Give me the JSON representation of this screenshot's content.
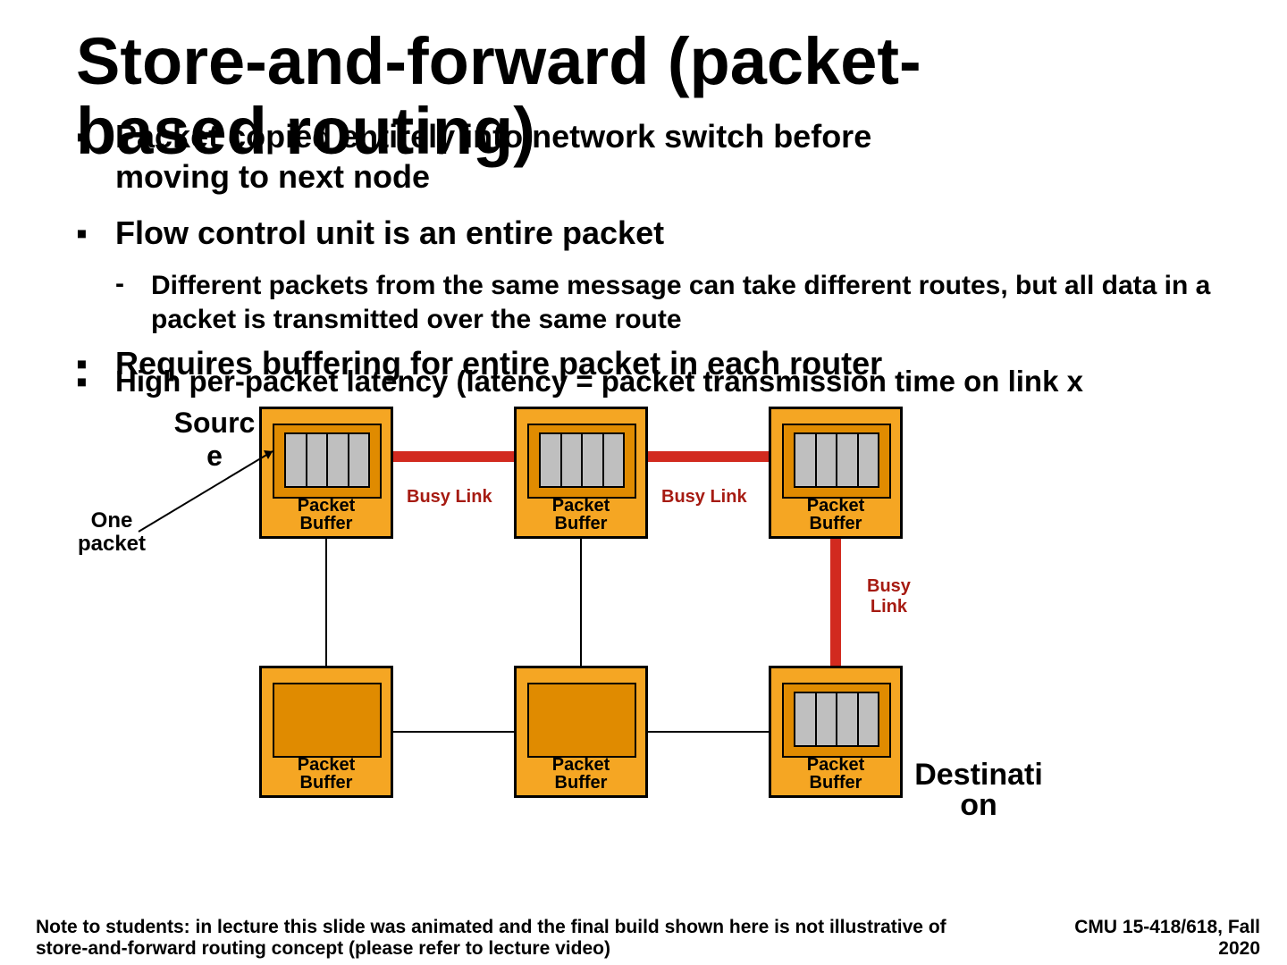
{
  "title_line1": "Store-and-forward (packet-",
  "title_line2": "based routing)",
  "bullets": {
    "b1a": "Packet copied entirely into network switch before",
    "b1b": "moving to next node",
    "b2": "Flow control unit is an entire packet",
    "b2sub": "Different packets from the same message can take different routes, but all data in a packet is transmitted over the same route",
    "overlapA": "Requires buffering for entire packet in each router",
    "overlapB": "High per-packet latency (latency = packet transmission time on link  x"
  },
  "diagram": {
    "source": "Sourc\ne",
    "one_packet": "One\npacket",
    "busy_link": "Busy Link",
    "busy_link_v": "Busy\nLink",
    "packet_buffer": "Packet\nBuffer",
    "destination": "Destinati\non"
  },
  "footer": {
    "note": "Note to students: in lecture this slide was animated and the final build shown here is not illustrative of store-and-forward routing concept (please refer to lecture video)",
    "course": "CMU 15-418/618, Fall 2020"
  }
}
